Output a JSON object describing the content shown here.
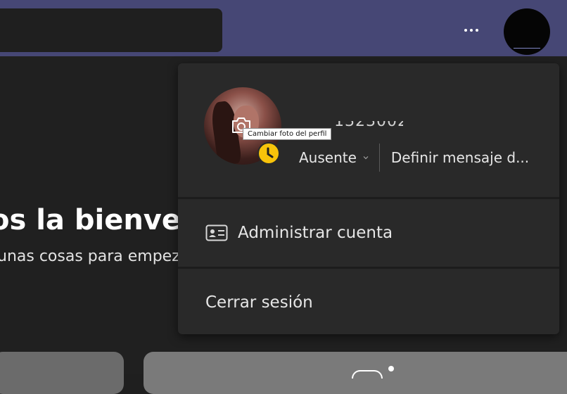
{
  "header": {
    "more_icon": "more-horizontal-icon",
    "avatar": "user-avatar"
  },
  "background": {
    "welcome_text": "os la bienver",
    "subtitle_text": "unas cosas para empez"
  },
  "profile_menu": {
    "photo_tooltip": "Cambiar foto del perfil",
    "name_partial": "13230024",
    "status": {
      "label": "Ausente",
      "color": "#f8c30a",
      "icon": "away-clock-icon"
    },
    "set_status_message": "Definir mensaje d...",
    "items": [
      {
        "label": "Administrar cuenta",
        "icon": "account-card-icon"
      },
      {
        "label": "Cerrar sesión"
      }
    ]
  },
  "colors": {
    "header_bg": "#464775",
    "app_bg": "#1f1f1f",
    "flyout_bg": "#292929",
    "accent": "#7f85c4"
  }
}
